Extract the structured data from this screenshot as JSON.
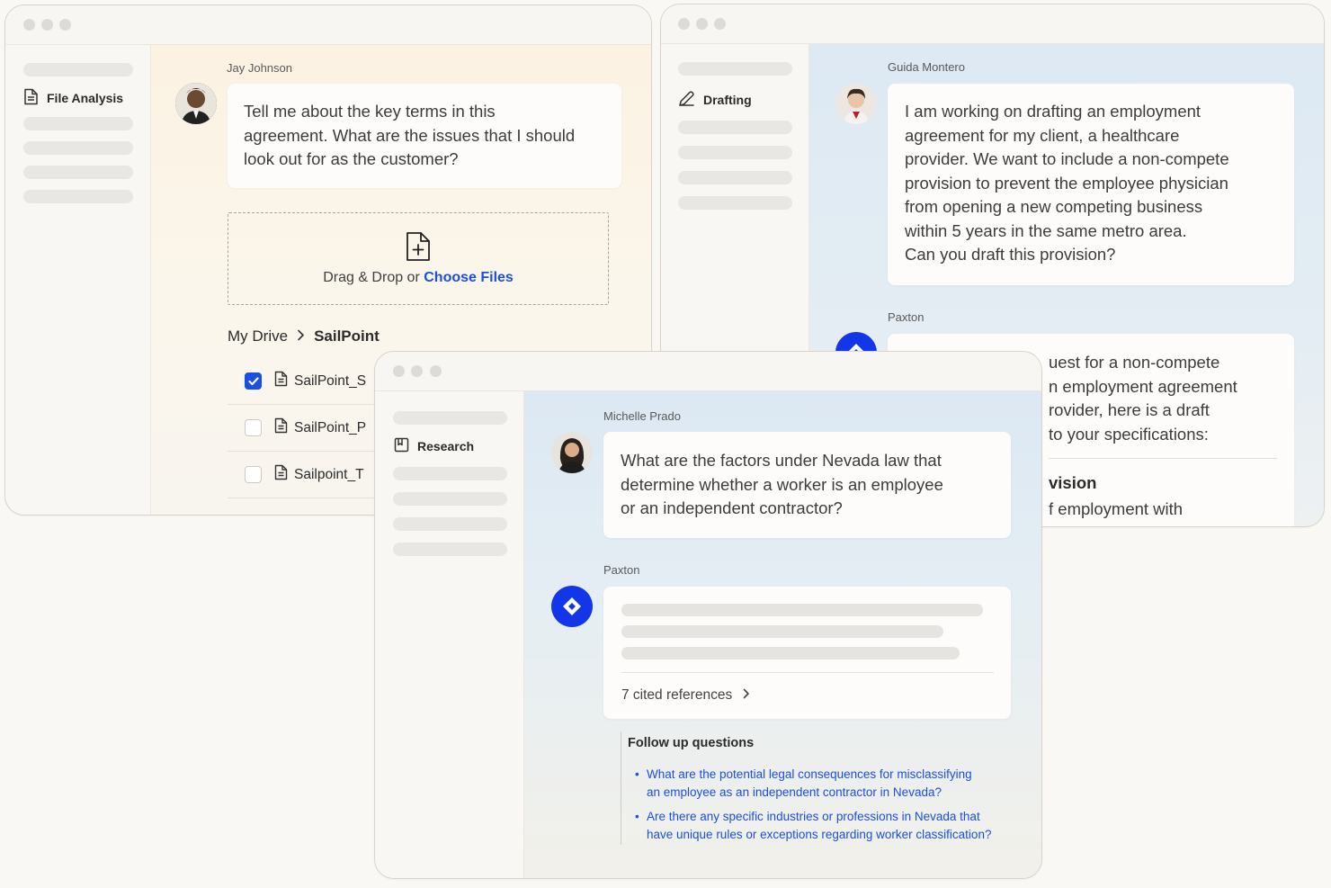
{
  "win1": {
    "sidebar": {
      "active_label": "File Analysis",
      "active_icon": "document-icon"
    },
    "message": {
      "user_name": "Jay Johnson",
      "lines": [
        "Tell me about the key terms in this",
        "agreement. What are the issues that I should",
        "look out for as the customer?"
      ]
    },
    "upload": {
      "text": "Drag & Drop or",
      "link": "Choose Files",
      "icon": "file-plus-icon"
    },
    "breadcrumb": {
      "root": "My Drive",
      "current": "SailPoint"
    },
    "files": [
      {
        "name": "SailPoint_S",
        "checked": true
      },
      {
        "name": "SailPoint_P",
        "checked": false
      },
      {
        "name": "Sailpoint_T",
        "checked": false
      }
    ]
  },
  "win2": {
    "sidebar": {
      "active_label": "Drafting",
      "active_icon": "pen-icon"
    },
    "message": {
      "user_name": "Guida Montero",
      "lines": [
        "I am working on drafting an employment",
        "agreement for my client, a healthcare",
        "provider. We want to include a non-compete",
        "provision to prevent the employee physician",
        "from opening a new competing business",
        "within 5 years in the same metro area.",
        "Can you draft this provision?"
      ]
    },
    "reply": {
      "name": "Paxton",
      "lines": [
        "uest for a non-compete",
        "n employment agreement",
        "rovider, here is a draft",
        "to your specifications:"
      ],
      "heading": "vision",
      "body": "f employment with"
    }
  },
  "win3": {
    "sidebar": {
      "active_label": "Research",
      "active_icon": "book-icon"
    },
    "message": {
      "user_name": "Michelle Prado",
      "lines": [
        "What are the factors under Nevada law that",
        "determine whether a worker is an employee",
        "or an independent contractor?"
      ]
    },
    "reply": {
      "name": "Paxton",
      "cited": "7 cited references"
    },
    "follow_up": {
      "title": "Follow up questions",
      "items": [
        {
          "line1": "What are the potential legal consequences for misclassifying",
          "line2": "an employee as an independent contractor in Nevada?"
        },
        {
          "line1": "Are there any specific industries or professions in Nevada that",
          "line2": "have unique rules or exceptions regarding worker classification?"
        }
      ]
    }
  },
  "colors": {
    "accent": "#1b4ee3",
    "paxton_logo": "#1236e8"
  }
}
